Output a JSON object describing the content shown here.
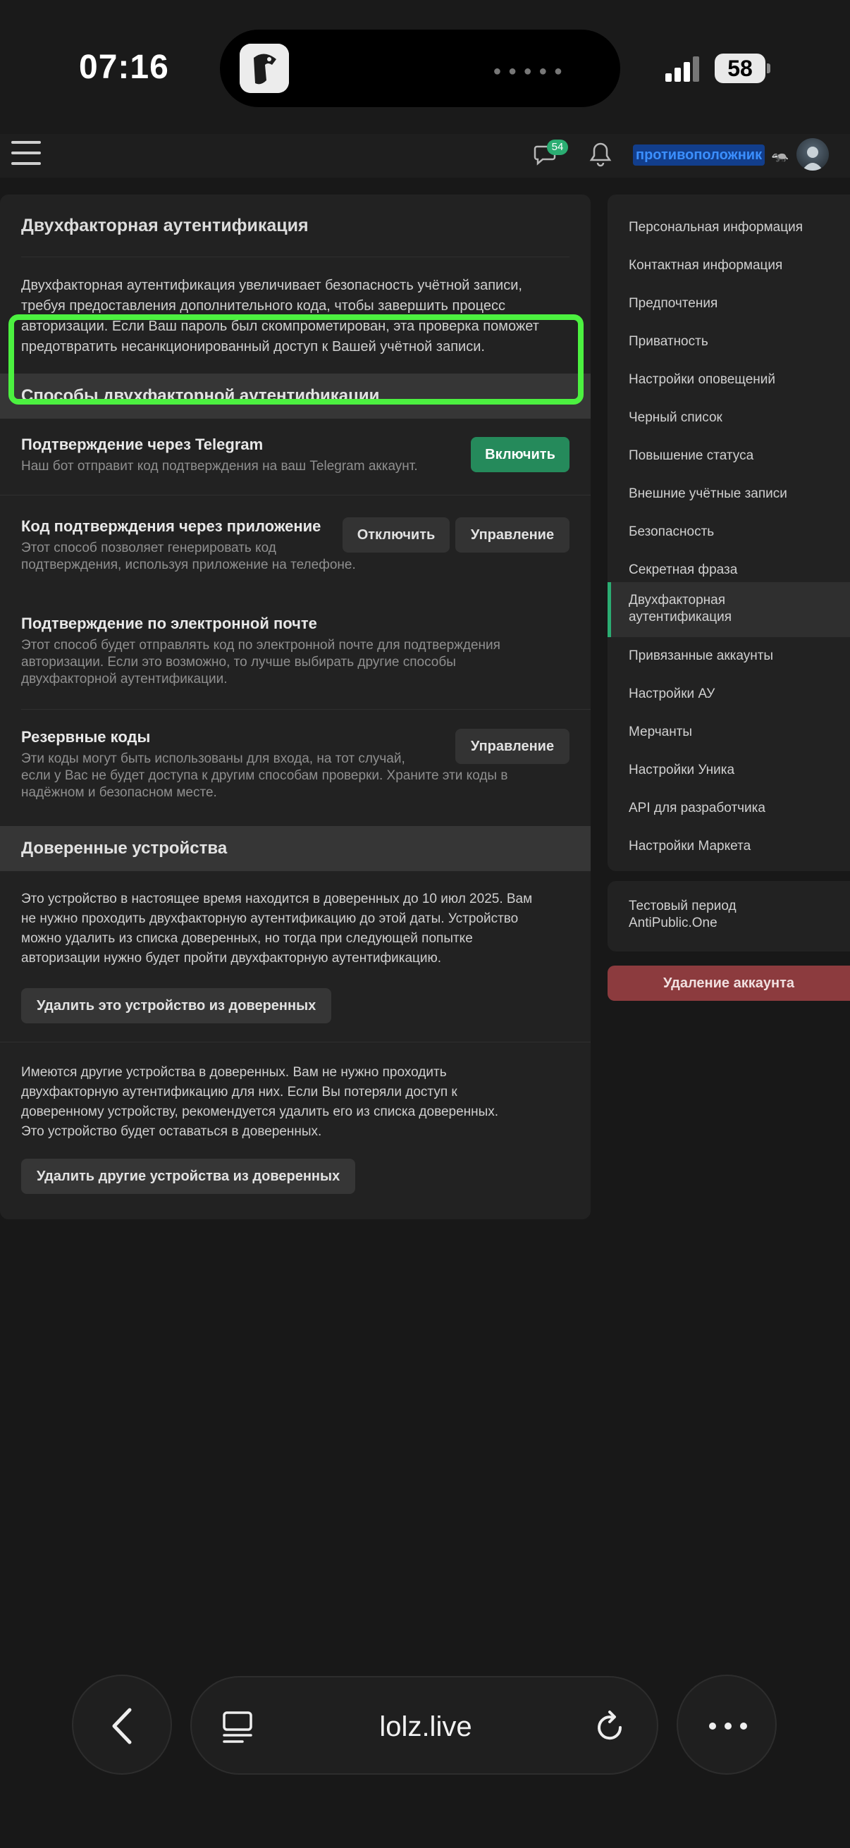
{
  "status_bar": {
    "time": "07:16",
    "battery": "58"
  },
  "topnav": {
    "messages_count": "54",
    "username": "противоположник",
    "username_emoji": "🦡"
  },
  "main": {
    "title": "Двухфакторная аутентификация",
    "intro": [
      "Двухфакторная аутентификация увеличивает безопасность учётной записи,",
      "требуя предоставления дополнительного кода, чтобы завершить процесс",
      "авторизации. Если Ваш пароль был скомпрометирован, эта проверка поможет",
      "предотвратить несанкционированный доступ к Вашей учётной записи."
    ],
    "methods_header": "Способы двухфакторной аутентификации",
    "methods": [
      {
        "title": "Подтверждение через Telegram",
        "desc": [
          "Наш бот отправит код подтверждения на ваш Telegram аккаунт."
        ],
        "buttons": [
          "Включить"
        ]
      },
      {
        "title": "Код подтверждения через приложение",
        "desc": [
          "Этот способ позволяет генерировать код",
          "подтверждения, используя приложение на телефоне."
        ],
        "buttons": [
          "Отключить",
          "Управление"
        ]
      },
      {
        "title": "Подтверждение по электронной почте",
        "desc": [
          "Этот способ будет отправлять код по электронной почте для подтверждения",
          "авторизации. Если это возможно, то лучше выбирать другие способы",
          "двухфакторной аутентификации."
        ],
        "buttons": []
      },
      {
        "title": "Резервные коды",
        "desc": [
          "Эти коды могут быть использованы для входа, на тот случай,",
          "если у Вас не будет доступа к другим способам проверки. Храните эти коды в",
          "надёжном и безопасном месте."
        ],
        "buttons": [
          "Управление"
        ]
      }
    ],
    "trusted_header": "Доверенные устройства",
    "trusted_text": [
      "Это устройство в настоящее время находится в доверенных до 10 июл 2025. Вам",
      "не нужно проходить двухфакторную аутентификацию до этой даты. Устройство",
      "можно удалить из списка доверенных, но тогда при следующей попытке",
      "авторизации нужно будет пройти двухфакторную аутентификацию."
    ],
    "remove_this_button": "Удалить это устройство из доверенных",
    "other_text": [
      "Имеются другие устройства в доверенных. Вам не нужно проходить",
      "двухфакторную аутентификацию для них. Если Вы потеряли доступ к",
      "доверенному устройству, рекомендуется удалить его из списка доверенных.",
      "Это устройство будет оставаться в доверенных."
    ],
    "remove_others_button": "Удалить другие устройства из доверенных"
  },
  "sidebar": {
    "items": [
      {
        "label": "Персональная информация"
      },
      {
        "label": "Контактная информация"
      },
      {
        "label": "Предпочтения"
      },
      {
        "label": "Приватность"
      },
      {
        "label": "Настройки оповещений"
      },
      {
        "label": "Черный список"
      },
      {
        "label": "Повышение статуса"
      },
      {
        "label": "Внешние учётные записи"
      },
      {
        "label": "Безопасность"
      },
      {
        "label": "Секретная фраза"
      },
      {
        "label": "Двухфакторная аутентификация",
        "lines": [
          "Двухфакторная",
          "аутентификация"
        ],
        "active": true
      },
      {
        "label": "Привязанные аккаунты"
      },
      {
        "label": "Настройки АУ"
      },
      {
        "label": "Мерчанты"
      },
      {
        "label": "Настройки Уника"
      },
      {
        "label": "API для разработчика"
      },
      {
        "label": "Настройки Маркета"
      }
    ],
    "trial": [
      "Тестовый период",
      "AntiPublic.One"
    ],
    "delete_account": "Удаление аккаунта"
  },
  "browser": {
    "url": "lolz.live"
  },
  "colors": {
    "accent_green": "#2bad72",
    "highlight": "#4cf140",
    "danger": "#8c3b3e",
    "username_bg": "#123e8c"
  }
}
